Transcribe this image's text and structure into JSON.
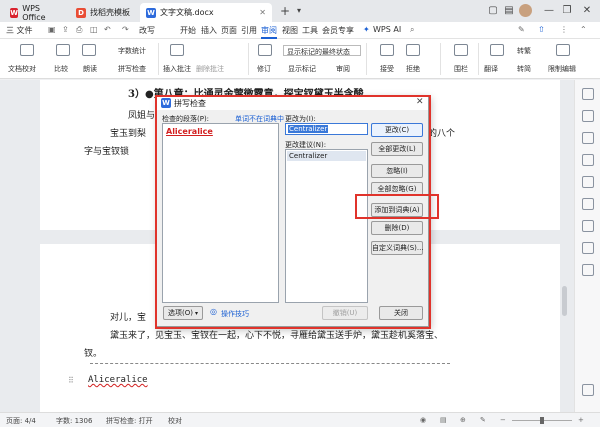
{
  "tabs": [
    {
      "label": "WPS Office",
      "icon": "wps-logo-icon"
    },
    {
      "label": "找稻壳模板",
      "icon": "docer-icon"
    },
    {
      "label": "文字文稿.docx",
      "icon": "word-doc-icon"
    }
  ],
  "menu": {
    "file": "三 文件",
    "items": [
      "开始",
      "插入",
      "页面",
      "引用",
      "审阅",
      "视图",
      "工具",
      "会员专享"
    ],
    "active": "审阅",
    "wps_ai": "WPS AI",
    "edit_label": "改写"
  },
  "ribbon": {
    "proofread": "文档校对",
    "compare": "比较",
    "read": "朗读",
    "word_count": "字数统计",
    "spell_check": "拼写检查",
    "insert_comment": "插入批注",
    "delete_comment": "删除批注",
    "revise": "修订",
    "markup_select": "显示标记的最终状态",
    "show_markup": "显示标记",
    "review": "审阅",
    "accept": "接受",
    "reject": "拒绝",
    "fence": "围栏",
    "translate": "翻译",
    "simp_trad": "转繁",
    "trad_simp": "转简",
    "restrict_edit": "限制编辑"
  },
  "document": {
    "heading": "3）●第八章：比通灵金莺微露意，探宝钗黛玉半含酸",
    "line1": "凤姐与",
    "line2": "宝玉到梨",
    "line2_right": "的八个",
    "line3": "字与宝钗锁",
    "line4_left": "对儿，宝",
    "line5": "黛玉来了，见宝玉、宝钗在一起，心下不悦，寻雁给黛玉送手炉，黛玉趁机奚落宝、",
    "line6": "钗。",
    "misspelled": "Aliceralice"
  },
  "dialog": {
    "title": "拼写检查",
    "not_in_dict_label": "检查的段落(P):",
    "not_in_dict_link": "单词不在词典中",
    "flagged_word": "Aliceralice",
    "change_to_label": "更改为(I):",
    "change_to_value": "Centralizer",
    "suggestions_label": "更改建议(N):",
    "suggestions": [
      "Centralizer"
    ],
    "buttons": {
      "change": "更改(C)",
      "change_all": "全部更改(L)",
      "ignore": "忽略(I)",
      "ignore_all": "全部忽略(G)",
      "add_to_dict": "添加到词典(A)",
      "delete": "删除(D)",
      "custom_dict": "自定义词典(S)...",
      "options": "选项(O)",
      "undo": "撤销(U)",
      "close": "关闭"
    },
    "tips": "操作技巧"
  },
  "statusbar": {
    "page": "页面: 4/4",
    "words": "字数: 1306",
    "spell": "拼写检查: 打开",
    "proof": "校对"
  },
  "colors": {
    "accent": "#1a5fd3",
    "misspelled": "#d21f1f",
    "highlight_box": "#e0332b"
  }
}
